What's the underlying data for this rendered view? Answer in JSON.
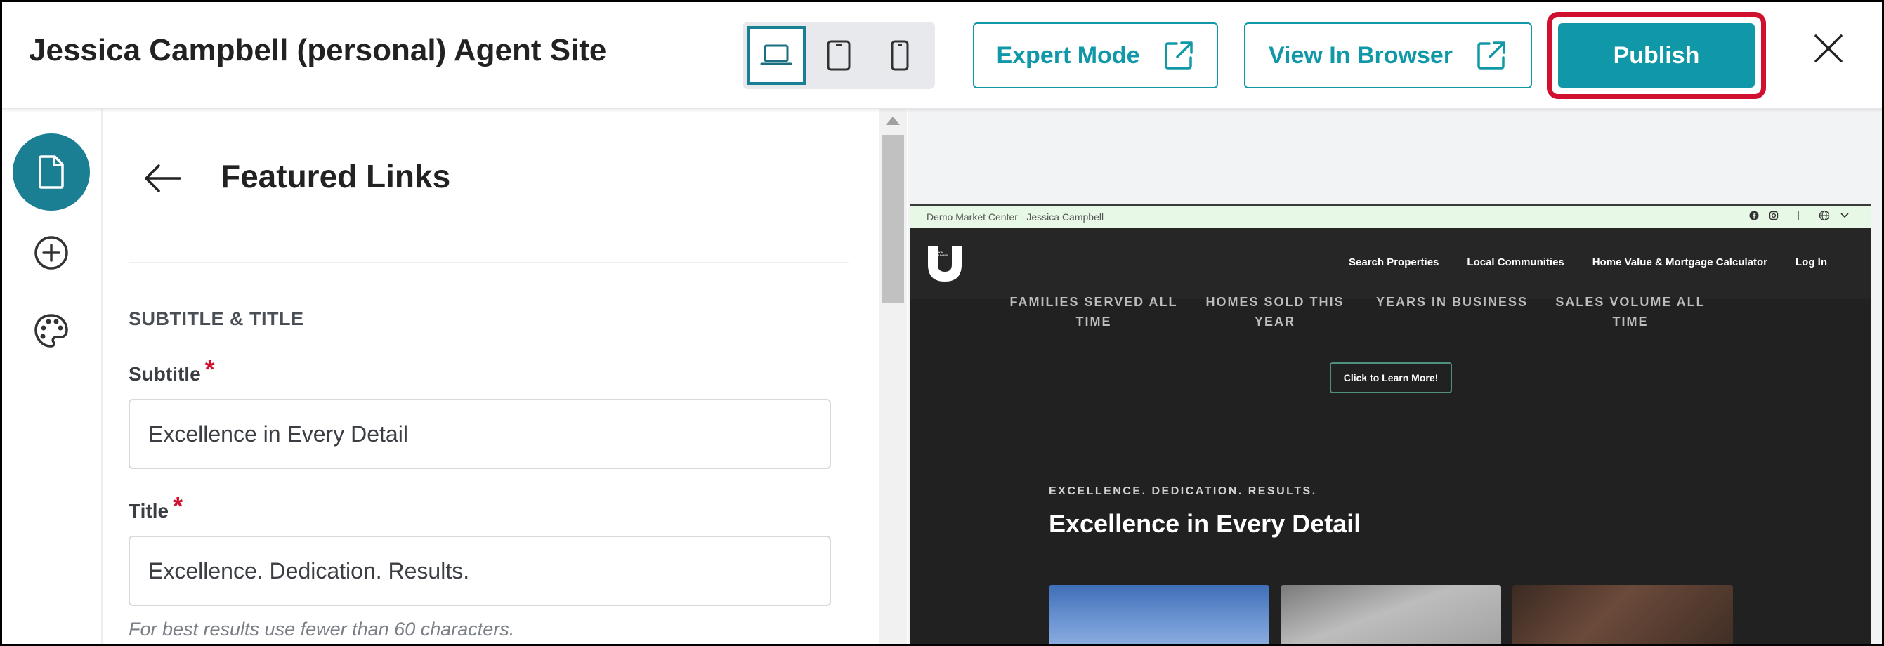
{
  "header": {
    "site_title": "Jessica Campbell (personal) Agent Site",
    "devices": [
      "laptop-icon",
      "tablet-icon",
      "phone-icon"
    ],
    "expert_mode_label": "Expert Mode",
    "view_in_browser_label": "View In Browser",
    "publish_label": "Publish"
  },
  "sidebar": {
    "items": [
      "page-icon",
      "add-icon",
      "palette-icon"
    ]
  },
  "panel": {
    "title": "Featured Links",
    "section_heading": "SUBTITLE & TITLE",
    "subtitle_label": "Subtitle",
    "subtitle_value": "Excellence in Every Detail",
    "title_label": "Title",
    "title_value": "Excellence. Dedication. Results.",
    "required_mark": "*",
    "hint": "For best results use fewer than 60 characters."
  },
  "preview": {
    "topbar_text": "Demo Market Center - Jessica Campbell",
    "logo_text": "KW UNIVERSITY",
    "nav": [
      "Search Properties",
      "Local Communities",
      "Home Value & Mortgage Calculator",
      "Log In"
    ],
    "stats": [
      "FAMILIES SERVED ALL TIME",
      "HOMES SOLD THIS YEAR",
      "YEARS IN BUSINESS",
      "SALES VOLUME ALL TIME"
    ],
    "learn_more_label": "Click to Learn More!",
    "section_subtitle": "EXCELLENCE. DEDICATION. RESULTS.",
    "section_title": "Excellence in Every Detail"
  },
  "colors": {
    "accent": "#1198a8",
    "publish_highlight": "#d0102e",
    "active_rail": "#1a7f93"
  }
}
